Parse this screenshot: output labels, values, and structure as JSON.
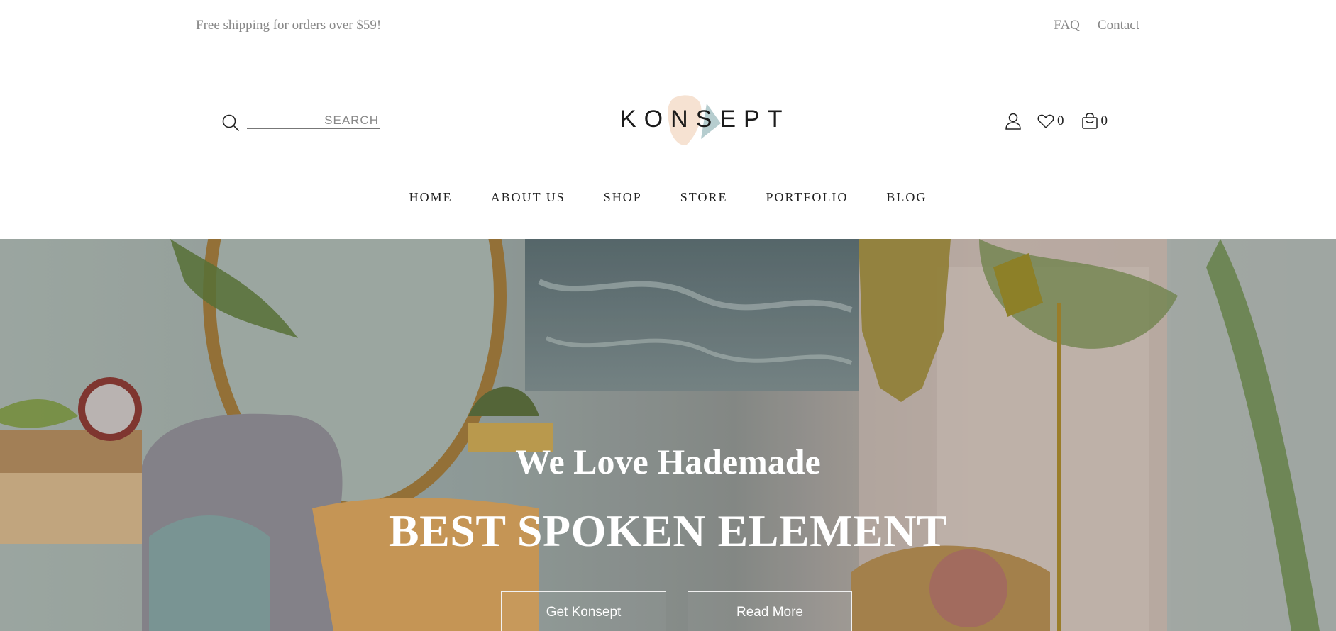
{
  "topbar": {
    "shipping_text": "Free shipping for orders over $59!",
    "links": [
      "FAQ",
      "Contact"
    ]
  },
  "header": {
    "search_placeholder": "SEARCH",
    "logo_text": "KONSEPT",
    "wishlist_count": "0",
    "cart_count": "0",
    "icons": [
      "search-icon",
      "user-icon",
      "heart-icon",
      "bag-icon"
    ]
  },
  "nav": {
    "items": [
      "HOME",
      "ABOUT US",
      "SHOP",
      "STORE",
      "PORTFOLIO",
      "BLOG"
    ]
  },
  "hero": {
    "subtitle": "We Love Hademade",
    "title": "BEST SPOKEN ELEMENT",
    "button_primary": "Get Konsept",
    "button_secondary": "Read More"
  },
  "colors": {
    "text_muted": "#888888",
    "text_dark": "#222222",
    "divider": "#9a9a9a",
    "logo_blob_peach": "#f5ddca",
    "logo_blob_teal": "#a9c4c7"
  }
}
